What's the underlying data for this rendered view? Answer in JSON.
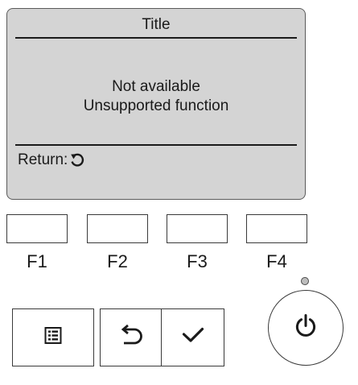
{
  "screen": {
    "title": "Title",
    "message_line1": "Not available",
    "message_line2": "Unsupported function",
    "return_label": "Return:",
    "return_icon": "return-arrow-icon"
  },
  "function_keys": [
    {
      "label": "F1"
    },
    {
      "label": "F2"
    },
    {
      "label": "F3"
    },
    {
      "label": "F4"
    }
  ],
  "buttons": {
    "menu_icon": "menu-list-icon",
    "back_icon": "return-arrow-icon",
    "confirm_icon": "checkmark-icon",
    "power_icon": "power-icon"
  },
  "colors": {
    "screen_background": "#d4d4d4",
    "outline": "#3a3a3a",
    "text": "#1a1a1a"
  }
}
